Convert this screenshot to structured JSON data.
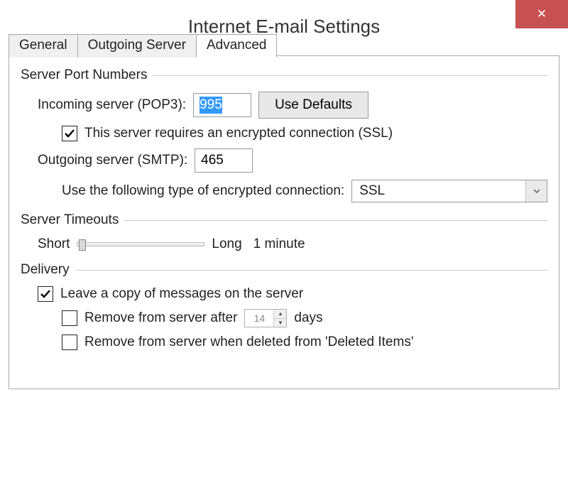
{
  "window": {
    "title": "Internet E-mail Settings",
    "close_glyph": "✕"
  },
  "tabs": {
    "general": "General",
    "outgoing": "Outgoing Server",
    "advanced": "Advanced"
  },
  "groups": {
    "ports": "Server Port Numbers",
    "timeouts": "Server Timeouts",
    "delivery": "Delivery"
  },
  "ports": {
    "incoming_label": "Incoming server (POP3):",
    "incoming_value": "995",
    "use_defaults": "Use Defaults",
    "ssl_checkbox": "This server requires an encrypted connection (SSL)",
    "outgoing_label": "Outgoing server (SMTP):",
    "outgoing_value": "465",
    "enc_label": "Use the following type of encrypted connection:",
    "enc_value": "SSL"
  },
  "timeouts": {
    "short": "Short",
    "long": "Long",
    "value": "1 minute"
  },
  "delivery": {
    "leave_copy": "Leave a copy of messages on the server",
    "remove_after_prefix": "Remove from server after",
    "remove_after_days_value": "14",
    "remove_after_suffix": "days",
    "remove_deleted": "Remove from server when deleted from 'Deleted Items'"
  }
}
